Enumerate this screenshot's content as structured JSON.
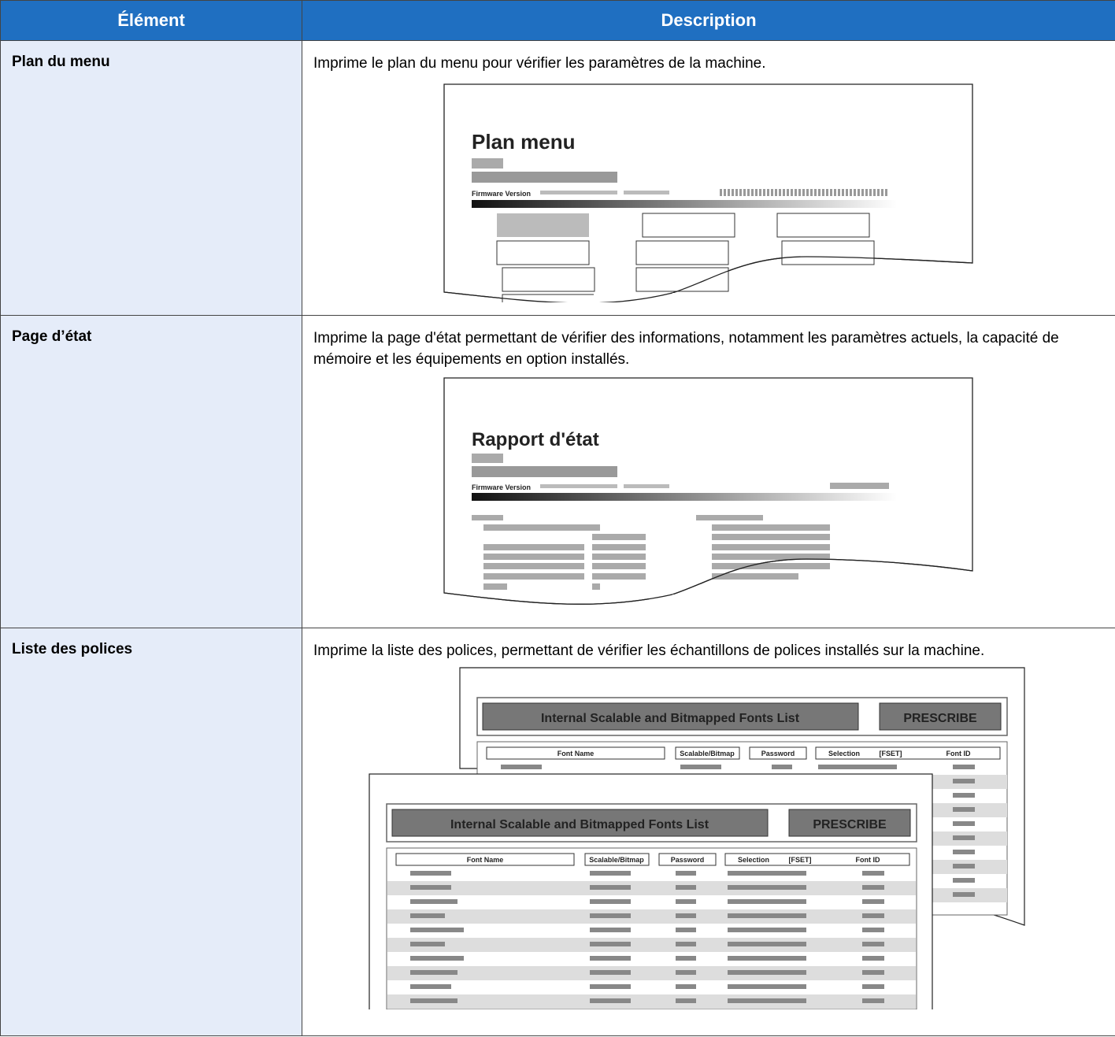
{
  "table": {
    "headers": {
      "item": "Élément",
      "description": "Description"
    },
    "rows": [
      {
        "item": "Plan du menu",
        "description": "Imprime le plan du menu pour vérifier les paramètres de la machine.",
        "illustration": {
          "title": "Plan menu",
          "firmware_label": "Firmware Version"
        }
      },
      {
        "item": "Page d’état",
        "description": "Imprime la page d'état permettant de vérifier des informations, notamment les paramètres actuels, la capacité de mémoire et les équipements en option installés.",
        "illustration": {
          "title": "Rapport d'état",
          "firmware_label": "Firmware Version"
        }
      },
      {
        "item": "Liste des polices",
        "description": "Imprime la liste des polices, permettant de vérifier les échantillons de polices installés sur la machine.",
        "illustration": {
          "list_title": "Internal Scalable and Bitmapped Fonts List",
          "brand": "PRESCRIBE",
          "columns": [
            "Font Name",
            "Scalable/Bitmap",
            "Password",
            "Selection",
            "[FSET]",
            "Font ID"
          ]
        }
      }
    ]
  }
}
